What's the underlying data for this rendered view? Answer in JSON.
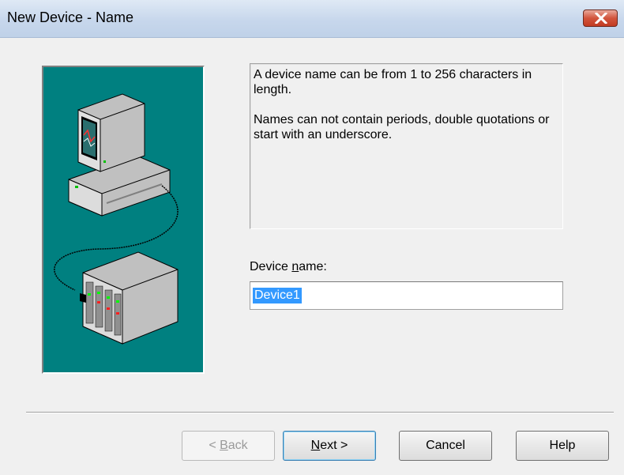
{
  "window": {
    "title": "New Device - Name"
  },
  "info": {
    "line1": "A device name can be from 1 to 256 characters in length.",
    "line2": "Names can not contain periods, double quotations or start with an underscore."
  },
  "field": {
    "label_pre": "Device ",
    "label_mnemonic": "n",
    "label_post": "ame:",
    "value": "Device1"
  },
  "buttons": {
    "back_pre": "< ",
    "back_mnemonic": "B",
    "back_post": "ack",
    "next_mnemonic": "N",
    "next_post": "ext >",
    "cancel": "Cancel",
    "help": "Help"
  },
  "colors": {
    "illustration_bg": "#008080",
    "selection": "#3399ff"
  }
}
